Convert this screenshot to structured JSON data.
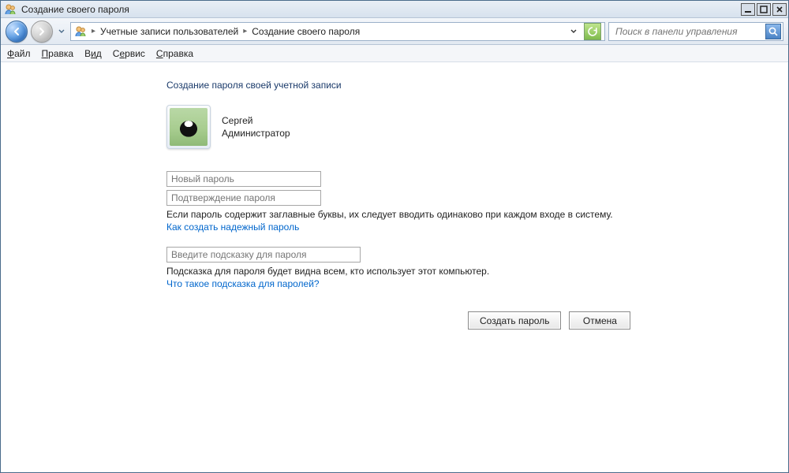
{
  "title": "Создание своего пароля",
  "breadcrumb": {
    "item1": "Учетные записи пользователей",
    "item2": "Создание своего пароля"
  },
  "search": {
    "placeholder": "Поиск в панели управления"
  },
  "menu": {
    "file": {
      "u": "Ф",
      "rest": "айл"
    },
    "edit": {
      "u": "П",
      "rest": "равка"
    },
    "view": {
      "pre": "В",
      "u": "и",
      "rest": "д"
    },
    "tools": {
      "pre": "С",
      "u": "е",
      "rest": "рвис"
    },
    "help": {
      "u": "С",
      "rest": "правка"
    }
  },
  "heading": "Создание пароля своей учетной записи",
  "user": {
    "name": "Сергей",
    "role": "Администратор"
  },
  "inputs": {
    "new_pw": "Новый пароль",
    "confirm_pw": "Подтверждение пароля",
    "hint": "Введите подсказку для пароля"
  },
  "texts": {
    "caps_warning": "Если пароль содержит заглавные буквы, их следует вводить одинаково при каждом входе в систему.",
    "link_strong": "Как создать надежный пароль",
    "hint_warning": "Подсказка для пароля будет видна всем, кто использует этот компьютер.",
    "link_hint": "Что такое подсказка для паролей?"
  },
  "buttons": {
    "create": "Создать пароль",
    "cancel": "Отмена"
  }
}
